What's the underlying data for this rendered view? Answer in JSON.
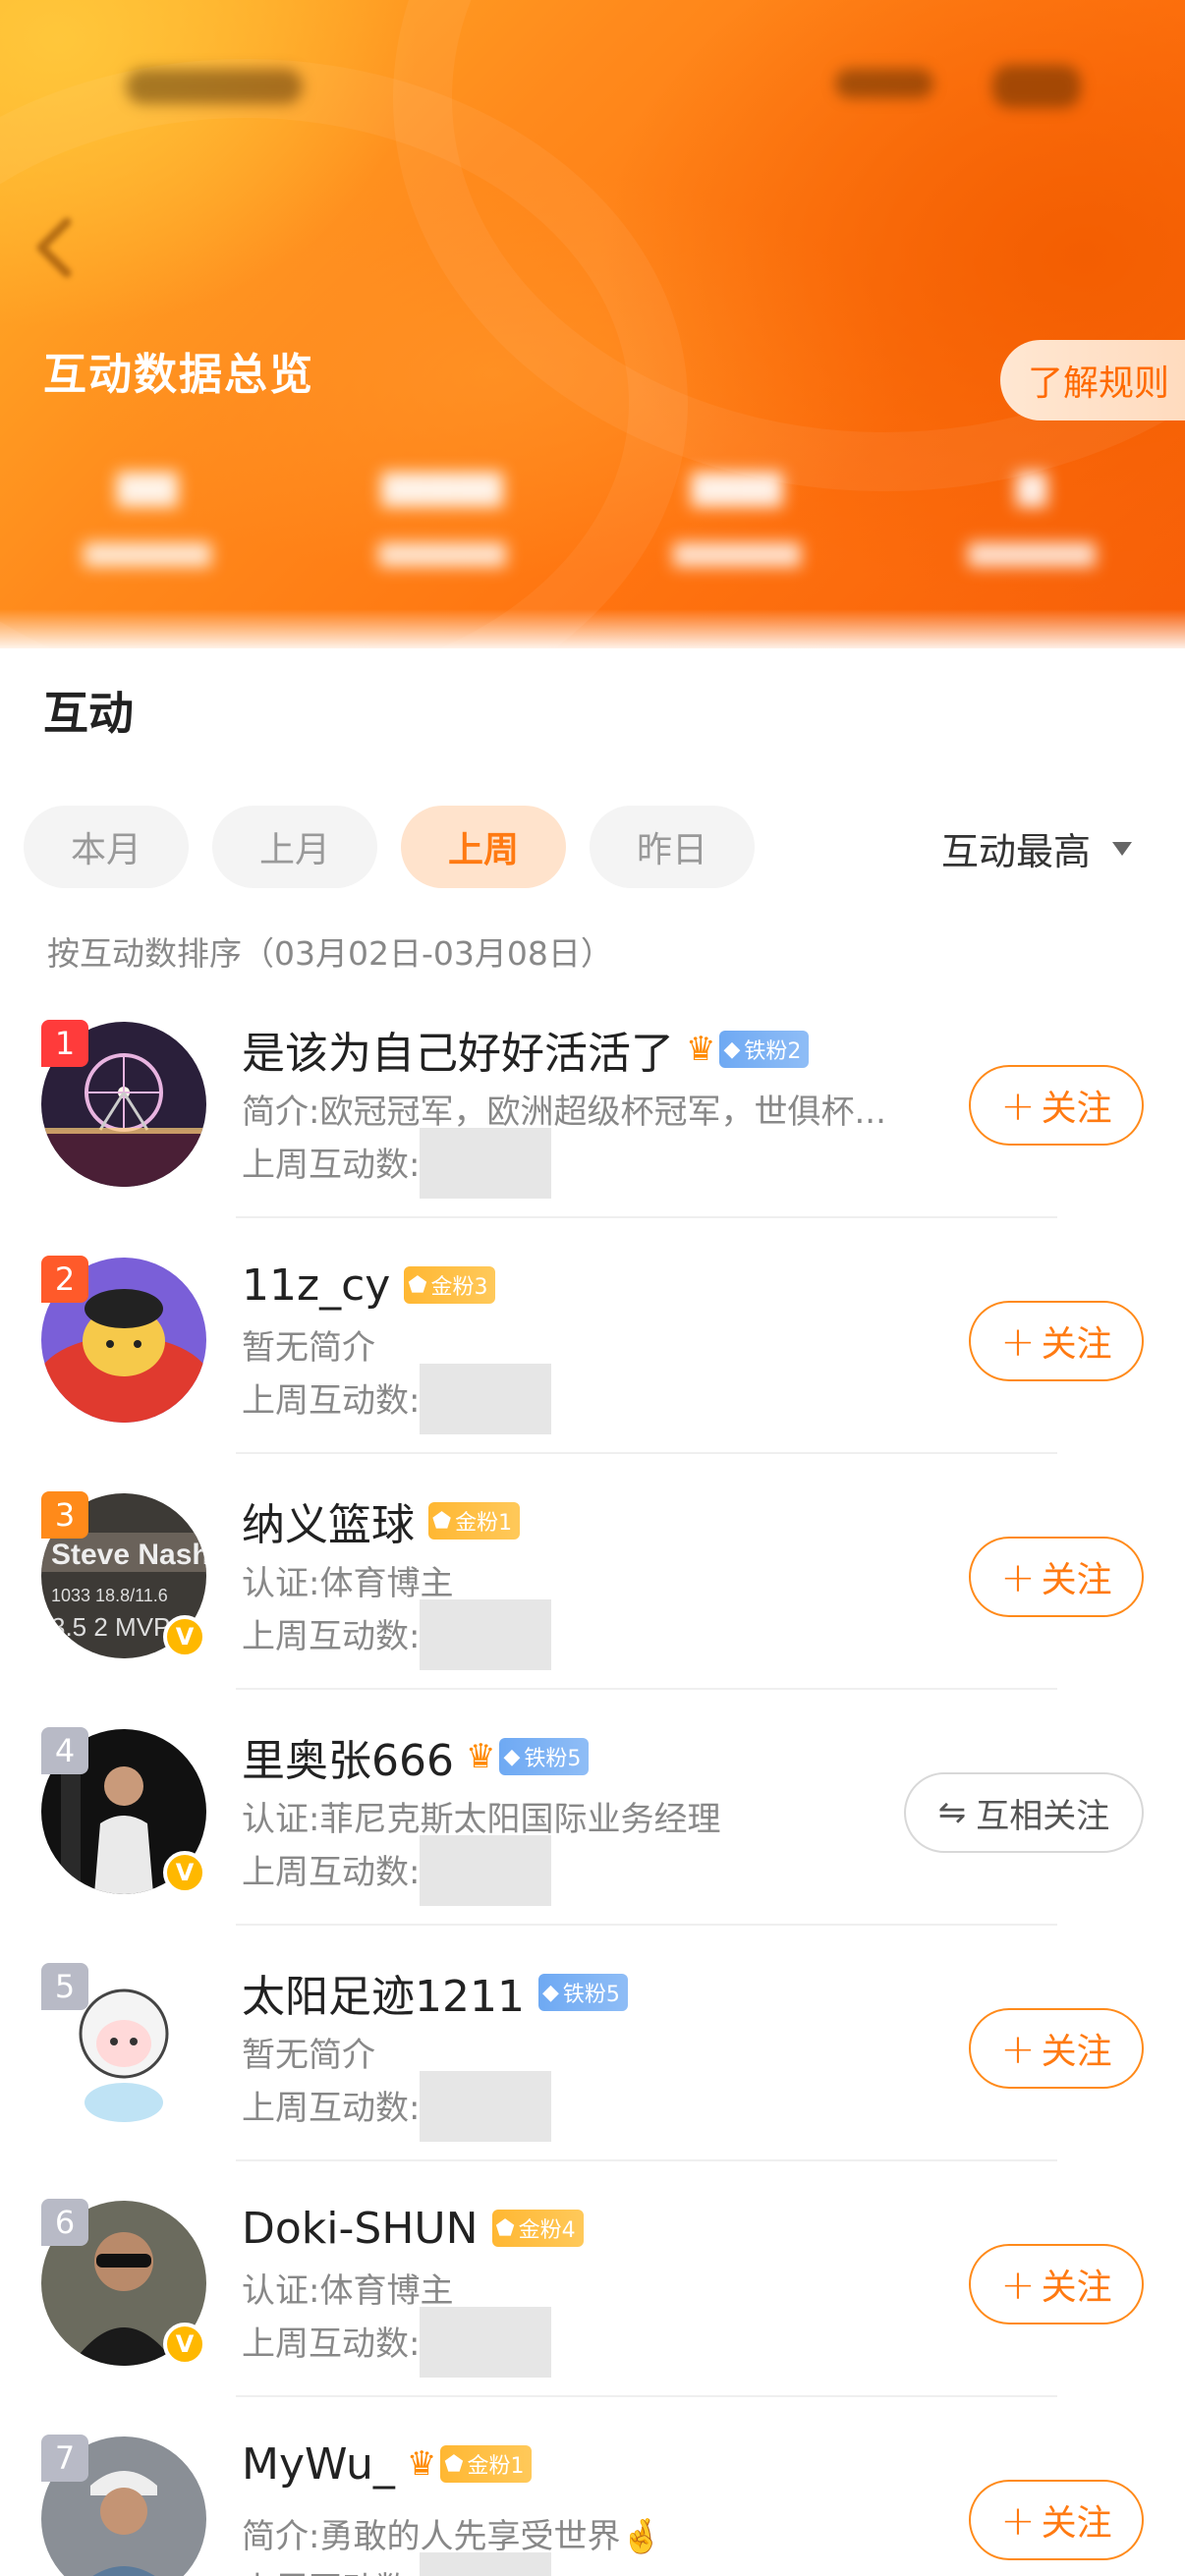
{
  "header": {
    "title": "互动数据总览",
    "rules_button": "了解规则",
    "stats_note": "stat values blurred in original"
  },
  "section": {
    "title": "互动",
    "tabs": [
      {
        "label": "本月",
        "active": false
      },
      {
        "label": "上月",
        "active": false
      },
      {
        "label": "上周",
        "active": true
      },
      {
        "label": "昨日",
        "active": false
      }
    ],
    "sort_label": "互动最高",
    "sort_note": "按互动数排序（03月02日-03月08日）"
  },
  "count_label": "上周互动数:",
  "follow_label": "关注",
  "mutual_label": "互相关注",
  "users": [
    {
      "rank": "1",
      "name": "是该为自己好好活活了",
      "badge": "铁粉2",
      "badge_type": "iron",
      "crown": true,
      "desc": "简介:欧冠冠军，欧洲超级杯冠军，世俱杯...",
      "verified": false,
      "relation": "follow",
      "avatar_icon": "ferris-wheel-avatar"
    },
    {
      "rank": "2",
      "name": "11z_cy",
      "badge": "金粉3",
      "badge_type": "gold",
      "crown": false,
      "desc": "暂无简介",
      "verified": false,
      "relation": "follow",
      "avatar_icon": "cartoon-avatar"
    },
    {
      "rank": "3",
      "name": "纳义篮球",
      "badge": "金粉1",
      "badge_type": "gold",
      "crown": false,
      "desc": "认证:体育博主",
      "verified": true,
      "relation": "follow",
      "avatar_icon": "basketball-player-avatar"
    },
    {
      "rank": "4",
      "name": "里奥张666",
      "badge": "铁粉5",
      "badge_type": "iron",
      "crown": true,
      "desc": "认证:菲尼克斯太阳国际业务经理",
      "verified": true,
      "relation": "mutual",
      "avatar_icon": "person-photo-avatar"
    },
    {
      "rank": "5",
      "name": "太阳足迹1211",
      "badge": "铁粉5",
      "badge_type": "iron",
      "crown": false,
      "desc": "暂无简介",
      "verified": false,
      "relation": "follow",
      "avatar_icon": "sheep-cartoon-avatar"
    },
    {
      "rank": "6",
      "name": "Doki-SHUN",
      "badge": "金粉4",
      "badge_type": "gold",
      "crown": false,
      "desc": "认证:体育博主",
      "verified": true,
      "relation": "follow",
      "avatar_icon": "person-sunglasses-avatar"
    },
    {
      "rank": "7",
      "name": "MyWu_",
      "badge": "金粉1",
      "badge_type": "gold",
      "crown": true,
      "desc": "简介:勇敢的人先享受世界🤞",
      "verified": false,
      "relation": "follow",
      "avatar_icon": "person-cap-avatar"
    }
  ],
  "colors": {
    "accent": "#ff7a12",
    "gold_badge": "#ffb732",
    "iron_badge": "#6ea9f3",
    "rank1": "#ff3b3b",
    "rank_other": "#b8bac6"
  }
}
